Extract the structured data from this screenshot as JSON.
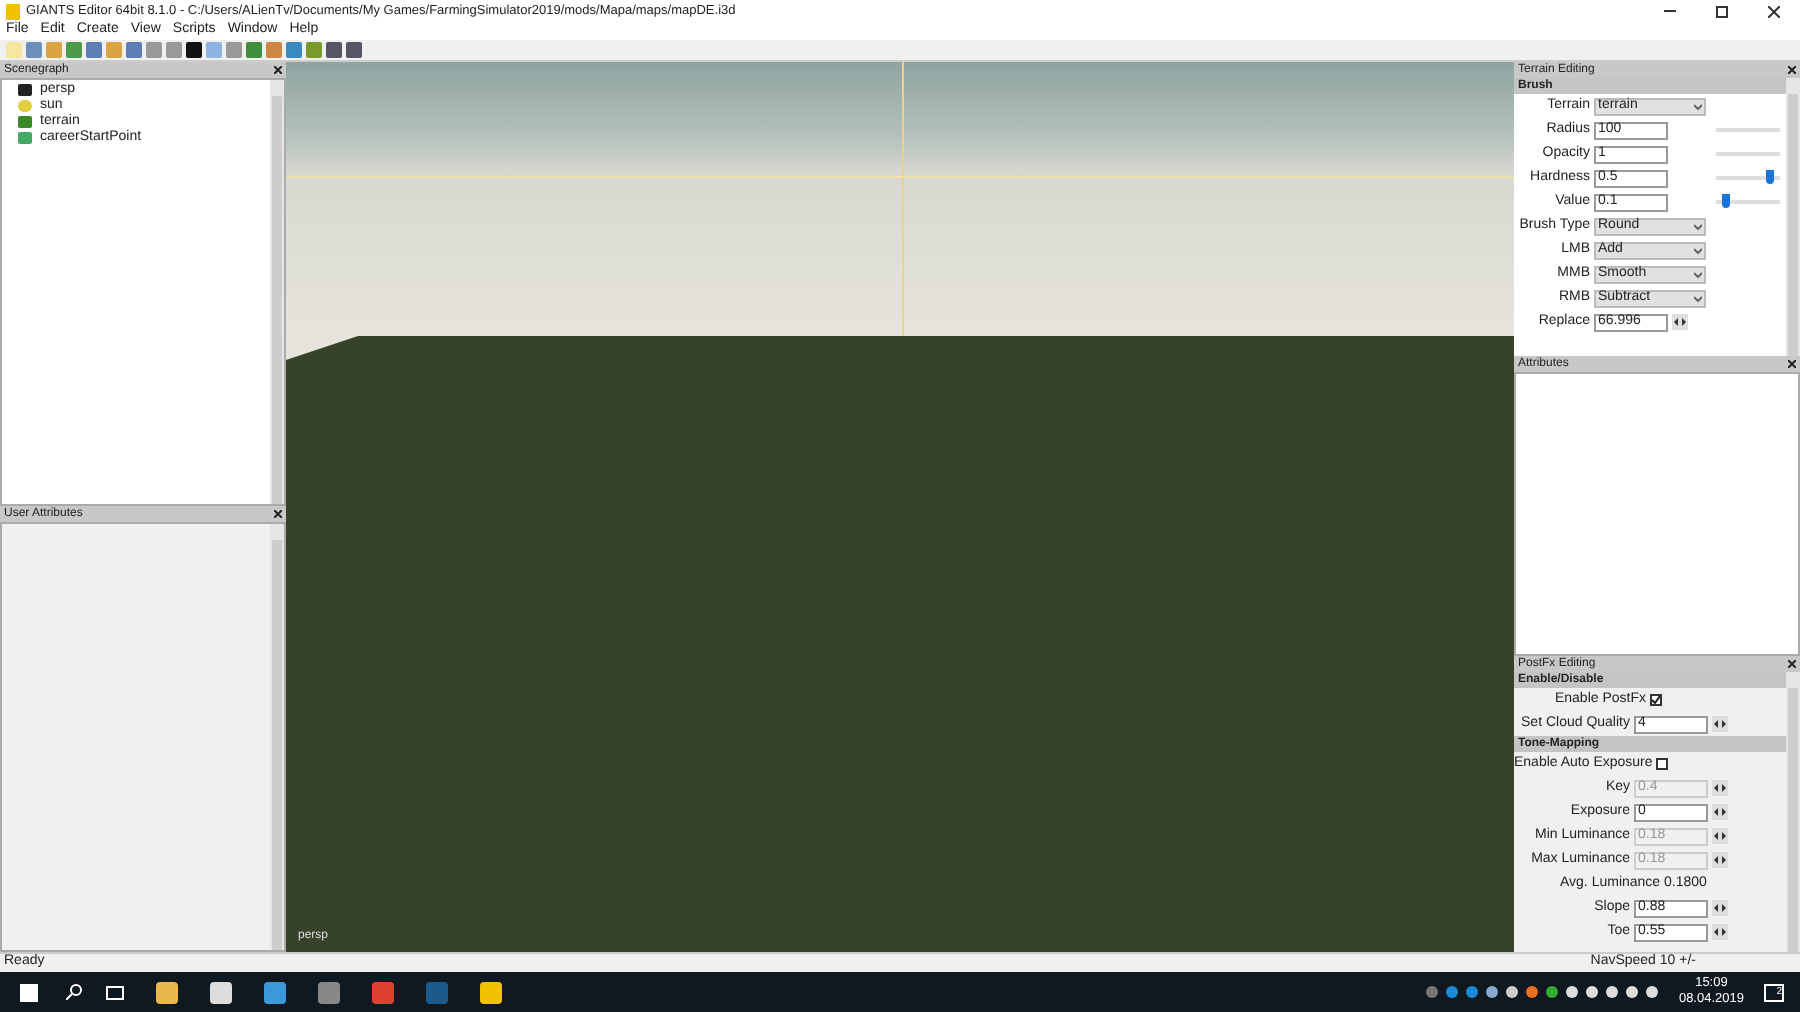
{
  "window": {
    "title": "GIANTS Editor 64bit 8.1.0 - C:/Users/ALienTv/Documents/My Games/FarmingSimulator2019/mods/Mapa/maps/mapDE.i3d"
  },
  "menu": [
    "File",
    "Edit",
    "Create",
    "View",
    "Scripts",
    "Window",
    "Help"
  ],
  "scenegraph": {
    "title": "Scenegraph",
    "items": [
      {
        "label": "persp",
        "kind": "camera"
      },
      {
        "label": "sun",
        "kind": "light"
      },
      {
        "label": "terrain",
        "kind": "terrain"
      },
      {
        "label": "careerStartPoint",
        "kind": "point"
      }
    ]
  },
  "user_attributes": {
    "title": "User Attributes"
  },
  "viewport": {
    "camera_label": "persp"
  },
  "terrain_editing": {
    "title": "Terrain Editing",
    "section": "Brush",
    "fields": [
      {
        "label": "Terrain",
        "kind": "select",
        "value": "terrain"
      },
      {
        "label": "Radius",
        "kind": "track",
        "value": "100"
      },
      {
        "label": "Opacity",
        "kind": "track",
        "value": "1"
      },
      {
        "label": "Hardness",
        "kind": "slider",
        "value": "0.5",
        "level": 0.9
      },
      {
        "label": "Value",
        "kind": "slider",
        "value": "0.1",
        "level": 0.1
      },
      {
        "label": "Brush Type",
        "kind": "select",
        "value": "Round"
      },
      {
        "label": "LMB",
        "kind": "select",
        "value": "Add"
      },
      {
        "label": "MMB",
        "kind": "select",
        "value": "Smooth"
      },
      {
        "label": "RMB",
        "kind": "select",
        "value": "Subtract"
      },
      {
        "label": "Replace",
        "kind": "spin",
        "value": "66.996",
        "disabled": false
      }
    ]
  },
  "attributes": {
    "title": "Attributes"
  },
  "postfx_editing": {
    "title": "PostFx Editing",
    "sections": [
      {
        "title": "Enable/Disable",
        "fields": [
          {
            "label": "Enable PostFx",
            "kind": "checkbox",
            "checked": true
          },
          {
            "label": "Set Cloud Quality",
            "kind": "spin",
            "value": "4",
            "disabled": false
          }
        ]
      },
      {
        "title": "Tone-Mapping",
        "fields": [
          {
            "label": "Enable Auto Exposure",
            "kind": "checkbox",
            "checked": false
          },
          {
            "label": "Key",
            "kind": "spin",
            "value": "0.4",
            "disabled": true
          },
          {
            "label": "Exposure",
            "kind": "spin",
            "value": "0",
            "disabled": false
          },
          {
            "label": "Min Luminance",
            "kind": "spin",
            "value": "0.18",
            "disabled": true
          },
          {
            "label": "Max Luminance",
            "kind": "spin",
            "value": "0.18",
            "disabled": true
          },
          {
            "label": "Avg. Luminance 0.1800",
            "kind": "text"
          },
          {
            "label": "Slope",
            "kind": "spin",
            "value": "0.88",
            "disabled": false
          },
          {
            "label": "Toe",
            "kind": "spin",
            "value": "0.55",
            "disabled": false
          }
        ]
      }
    ]
  },
  "status_bar": {
    "left": "Ready",
    "right": "NavSpeed 10 +/-"
  },
  "taskbar": {
    "time": "15:09",
    "date": "08.04.2019",
    "notifications": "2"
  }
}
